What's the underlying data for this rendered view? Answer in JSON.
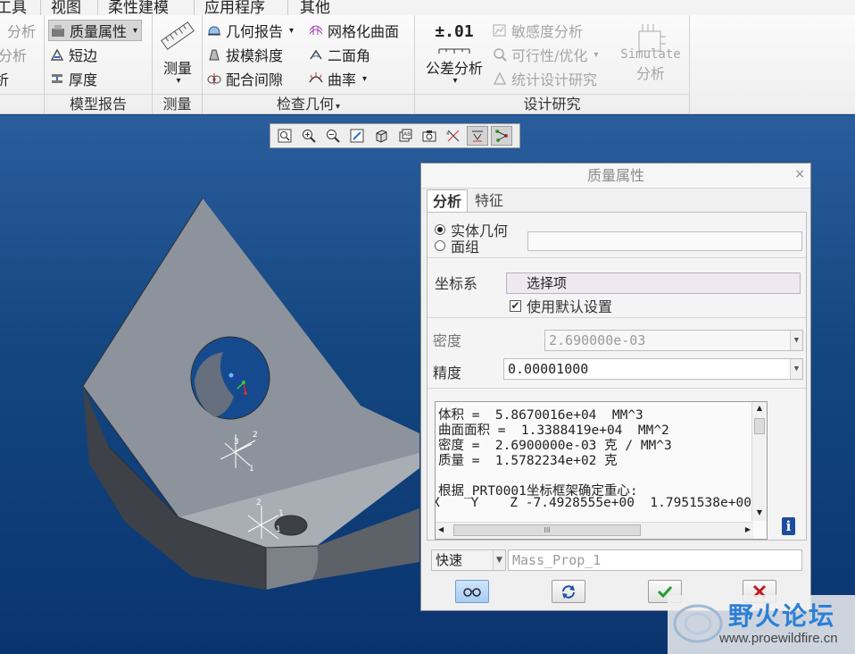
{
  "menu": {
    "items": [
      "工具",
      "视图",
      "柔性建模",
      "应用程序",
      "其他"
    ]
  },
  "ribbon": {
    "groups": [
      {
        "label": "模型报告"
      },
      {
        "label": "测量"
      },
      {
        "label": "检查几何"
      },
      {
        "label": "设计研究"
      }
    ],
    "analysis_partial": [
      "分析",
      "分析",
      "析"
    ],
    "mass_props": "质量属性",
    "short_edge": "短边",
    "thickness": "厚度",
    "measure": "测量",
    "geom_report": "几何报告",
    "draft": "拔模斜度",
    "clearance": "配合间隙",
    "mesh_surface": "网格化曲面",
    "dihedral": "二面角",
    "curvature": "曲率",
    "tolerance_icon_text": "±.01",
    "tolerance_analysis": "公差分析",
    "sensitivity": "敏感度分析",
    "feasibility": "可行性/优化",
    "stat_design": "统计设计研究",
    "simulate_1": "Simulate",
    "simulate_2": "分析"
  },
  "model": {
    "triads": [
      {
        "labels": [
          "3",
          "2",
          "1"
        ]
      },
      {
        "labels": [
          "2",
          "1",
          "1"
        ]
      }
    ]
  },
  "dialog": {
    "title": "质量属性",
    "close": "×",
    "tabs": [
      "分析",
      "特征"
    ],
    "solid": "实体几何",
    "quilt": "面组",
    "csys_label": "坐标系",
    "select_item": "选择项",
    "use_default": "使用默认设置",
    "density_label": "密度",
    "density_value": "2.690000e-03",
    "precision_label": "精度",
    "precision_value": "0.00001000",
    "results": [
      "体积 =  5.8670016e+04  MM^3",
      "曲面面积 =  1.3388419e+04  MM^2",
      "密度 =  2.6900000e-03 克 / MM^3",
      "质量 =  1.5782234e+02 克",
      "",
      "根据_PRT0001坐标框架确定重心:",
      "X    Y    Z -7.4928555e+00  1.7951538e+00"
    ],
    "scroll_thumb": "III",
    "mode": "快速",
    "name": "Mass_Prop_1"
  },
  "watermark": {
    "title": "野火论坛",
    "url": "www.proewildfire.cn"
  }
}
